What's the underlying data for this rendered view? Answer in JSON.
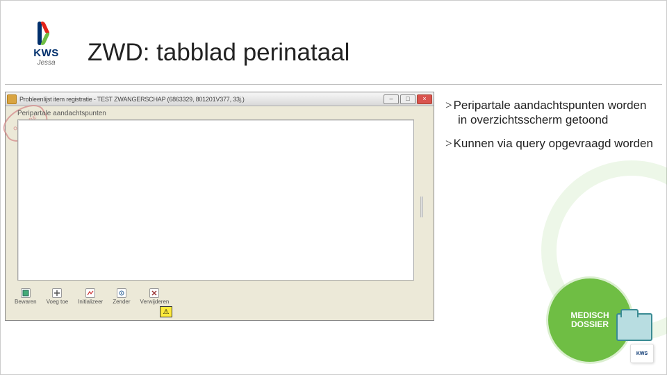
{
  "title": "ZWD: tabblad perinataal",
  "logo": {
    "line1": "KWS",
    "line2": "Jessa"
  },
  "window": {
    "title": "Probleenlijst item registratie - TEST ZWANGERSCHAP (6863329, 801201V377, 33j.)",
    "stamp": "OPLEIDE",
    "section_label": "Peripartale aandachtspunten",
    "toolbar": {
      "bewaren": "Bewaren",
      "voeg_toe": "Voeg toe",
      "initializeer": "Initializeer",
      "zender": "Zender",
      "verwijderen": "Verwijderen"
    }
  },
  "bullets": [
    "Peripartale aandachtspunten worden in overzichtsscherm getoond",
    "Kunnen via query opgevraagd worden"
  ],
  "badge": {
    "line1": "MEDISCH",
    "line2": "DOSSIER",
    "mini": "KWS"
  }
}
